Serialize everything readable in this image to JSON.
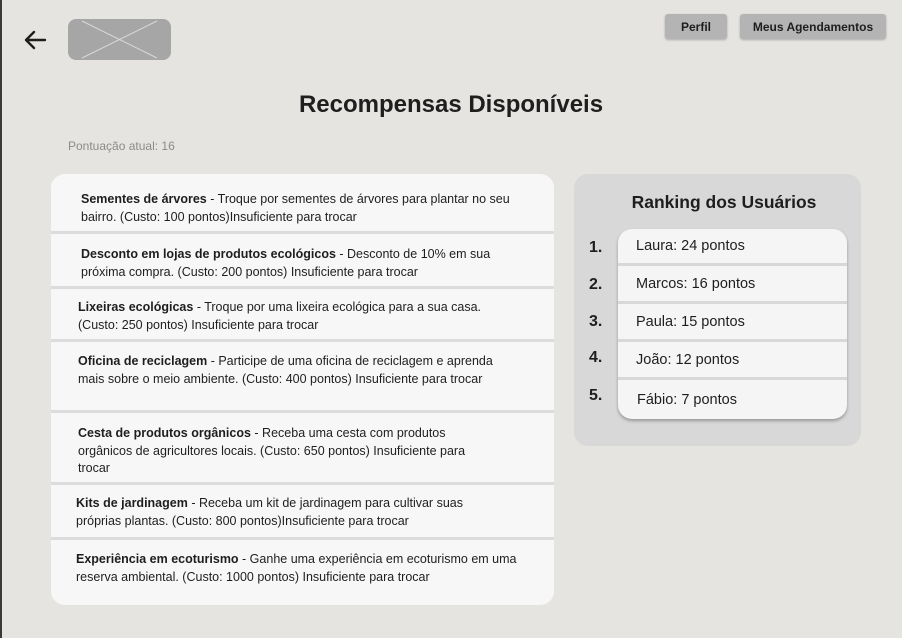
{
  "header": {
    "back_icon": "arrow-left-icon",
    "logo_icon": "image-placeholder-icon",
    "perfil_label": "Perfil",
    "agendamentos_label": "Meus Agendamentos"
  },
  "page": {
    "title": "Recompensas Disponíveis",
    "score_text": "Pontuação atual: 16"
  },
  "rewards": [
    {
      "name": "Sementes de árvores",
      "desc": " - Troque por sementes de árvores para plantar no seu bairro. (Custo: 100 pontos)Insuficiente para trocar"
    },
    {
      "name": "Desconto em lojas de produtos ecológicos",
      "desc": " - Desconto de 10% em sua próxima compra. (Custo: 200 pontos) Insuficiente para trocar"
    },
    {
      "name": "Lixeiras ecológicas",
      "desc": " - Troque por uma lixeira ecológica para a sua casa. (Custo: 250 pontos) Insuficiente para trocar"
    },
    {
      "name": "Oficina de reciclagem",
      "desc": " - Participe de uma oficina de reciclagem e aprenda mais sobre o meio ambiente. (Custo: 400 pontos) Insuficiente para trocar"
    },
    {
      "name": "Cesta de produtos orgânicos",
      "desc": " - Receba uma cesta com produtos orgânicos de agricultores locais. (Custo: 650 pontos) Insuficiente para trocar"
    },
    {
      "name": "Kits de jardinagem",
      "desc": " - Receba um kit de jardinagem para cultivar suas próprias plantas. (Custo: 800 pontos)Insuficiente para trocar"
    },
    {
      "name": "Experiência em ecoturismo",
      "desc": " - Ganhe uma experiência em ecoturismo em uma reserva ambiental. (Custo: 1000 pontos) Insuficiente para trocar"
    }
  ],
  "ranking": {
    "title": "Ranking dos Usuários",
    "numbers": [
      "1.",
      "2.",
      "3.",
      "4.",
      "5."
    ],
    "entries": [
      "Laura: 24 pontos",
      "Marcos: 16 pontos",
      "Paula: 15 pontos",
      "João: 12 pontos",
      "Fábio: 7 pontos"
    ]
  }
}
